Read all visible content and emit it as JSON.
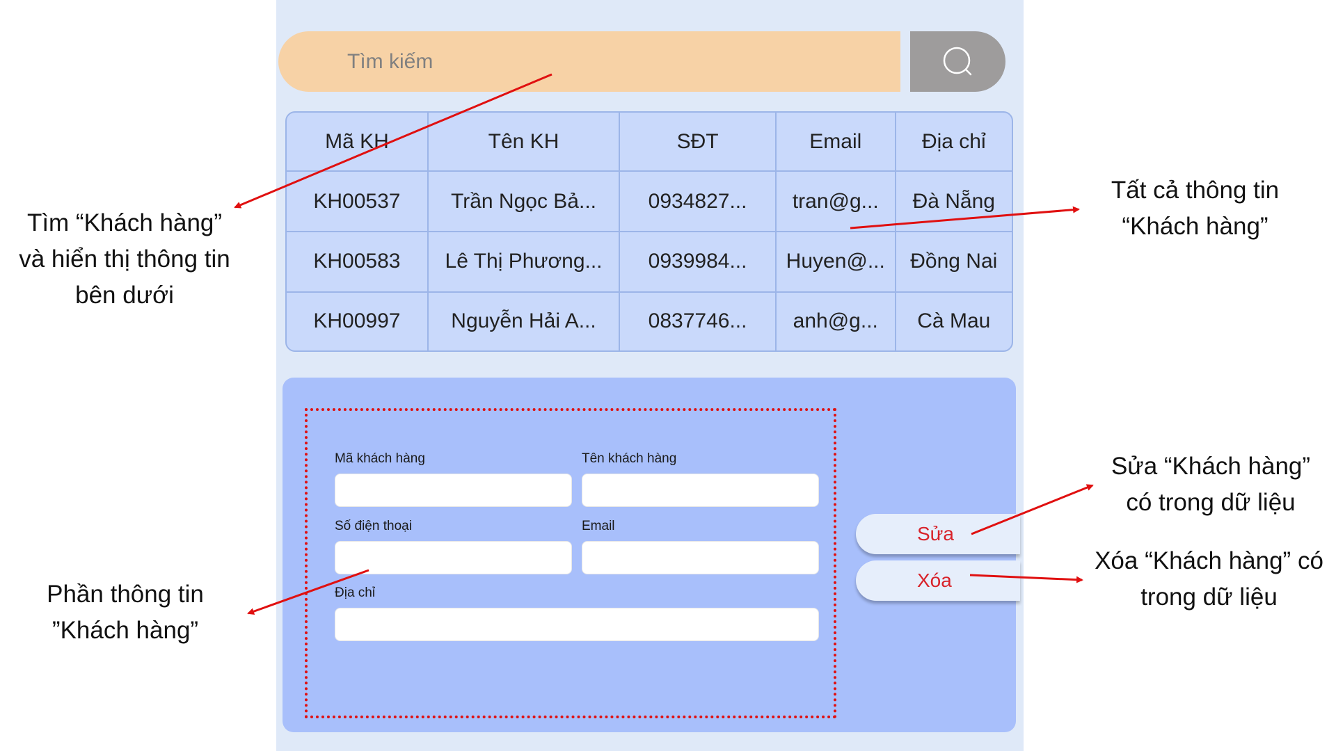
{
  "search": {
    "placeholder": "Tìm kiếm",
    "icon": "search-icon"
  },
  "table": {
    "headers": [
      "Mã KH",
      "Tên KH",
      "SĐT",
      "Email",
      "Địa chỉ"
    ],
    "rows": [
      [
        "KH00537",
        "Trần Ngọc Bả...",
        "0934827...",
        "tran@g...",
        "Đà Nẵng"
      ],
      [
        "KH00583",
        "Lê Thị Phương...",
        "0939984...",
        "Huyen@...",
        "Đồng Nai"
      ],
      [
        "KH00997",
        "Nguyễn Hải A...",
        "0837746...",
        "anh@g...",
        "Cà Mau"
      ]
    ]
  },
  "form": {
    "ma_label": "Mã khách hàng",
    "ten_label": "Tên khách hàng",
    "sdt_label": "Số điện thoại",
    "email_label": "Email",
    "diachi_label": "Địa chỉ"
  },
  "actions": {
    "edit_label": "Sửa",
    "delete_label": "Xóa"
  },
  "annotations": {
    "search_line1": "Tìm “Khách hàng”",
    "search_line2": "và hiển thị thông tin",
    "search_line3": "bên dưới",
    "all_info_line1": "Tất cả thông tin",
    "all_info_line2": "“Khách hàng”",
    "edit_line1": "Sửa “Khách hàng”",
    "edit_line2": "có trong dữ liệu",
    "delete_line1": "Xóa “Khách hàng” có",
    "delete_line2": "trong dữ liệu",
    "form_line1": "Phần thông tin",
    "form_line2": "”Khách hàng”"
  },
  "colors": {
    "phone_bg": "#dfe9f8",
    "search_bg": "#f7d2a6",
    "search_button_bg": "#9e9c9c",
    "table_bg": "#c9d9fb",
    "form_panel_bg": "#a8bffb",
    "action_text": "#d8222a",
    "arrow": "#e01010"
  }
}
